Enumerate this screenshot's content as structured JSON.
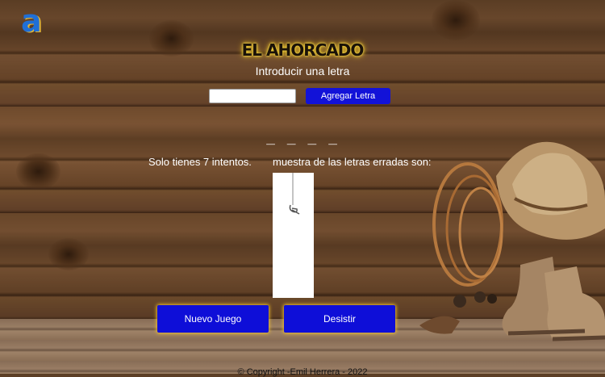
{
  "app": {
    "logo_letter": "a",
    "title": "EL AHORCADO",
    "subtitle": "Introducir una letra"
  },
  "form": {
    "input_value": "",
    "input_placeholder": "",
    "add_button_label": "Agregar Letra"
  },
  "game": {
    "word_display": "_ _ _ _",
    "tries_text": "Solo tienes 7 intentos.",
    "missed_text": "muestra de las letras erradas son:"
  },
  "buttons": {
    "new_game_label": "Nuevo Juego",
    "quit_label": "Desistir"
  },
  "footer": {
    "copyright": "© Copyright -Emil Herrera - 2022"
  },
  "colors": {
    "button_blue": "#1212d8",
    "glow_gold": "#f2c12c",
    "title_glow": "#f5d53a"
  },
  "icons": {
    "logo": "stylized-a-logo-icon",
    "hat_boots": "cowboy-hat-and-boots-illustration"
  }
}
